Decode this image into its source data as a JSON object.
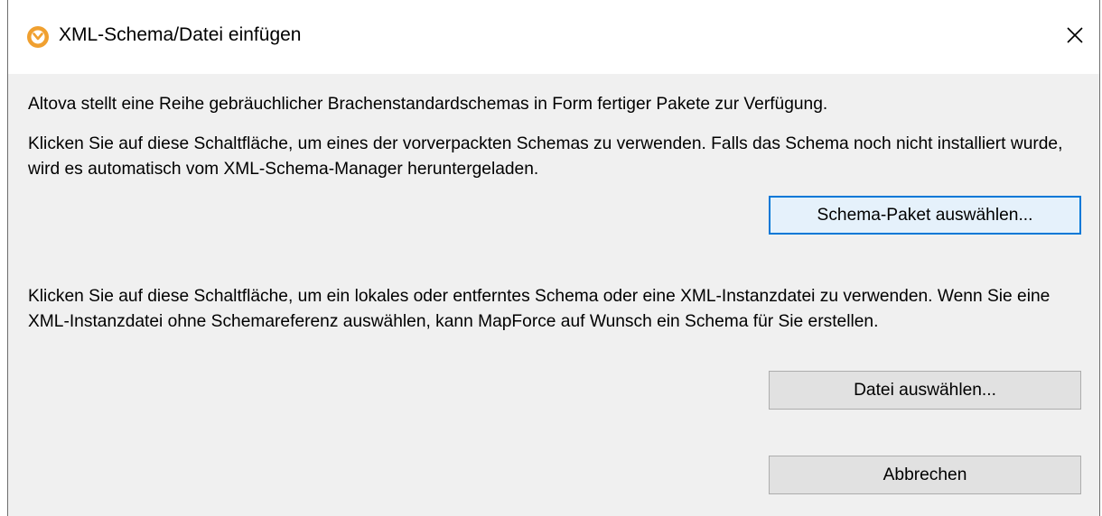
{
  "window": {
    "title": "XML-Schema/Datei einfügen",
    "app_icon": "altova-mapforce-icon",
    "close_icon": "close-icon"
  },
  "content": {
    "intro_text": "Altova stellt eine Reihe gebräuchlicher Brachenstandardschemas in Form fertiger Pakete zur Verfügung.",
    "package_text": "Klicken Sie auf diese Schaltfläche, um eines der vorverpackten Schemas zu verwenden. Falls das Schema noch nicht installiert wurde, wird es automatisch vom XML-Schema-Manager heruntergeladen.",
    "file_text": "Klicken Sie auf diese Schaltfläche, um ein lokales oder entferntes Schema oder eine XML-Instanzdatei zu verwenden. Wenn Sie eine XML-Instanzdatei ohne Schemareferenz auswählen, kann MapForce auf Wunsch ein Schema für Sie erstellen."
  },
  "buttons": {
    "select_package": "Schema-Paket auswählen...",
    "select_file": "Datei auswählen...",
    "cancel": "Abbrechen"
  },
  "colors": {
    "accent": "#0078d7",
    "icon_orange": "#f0a030"
  }
}
